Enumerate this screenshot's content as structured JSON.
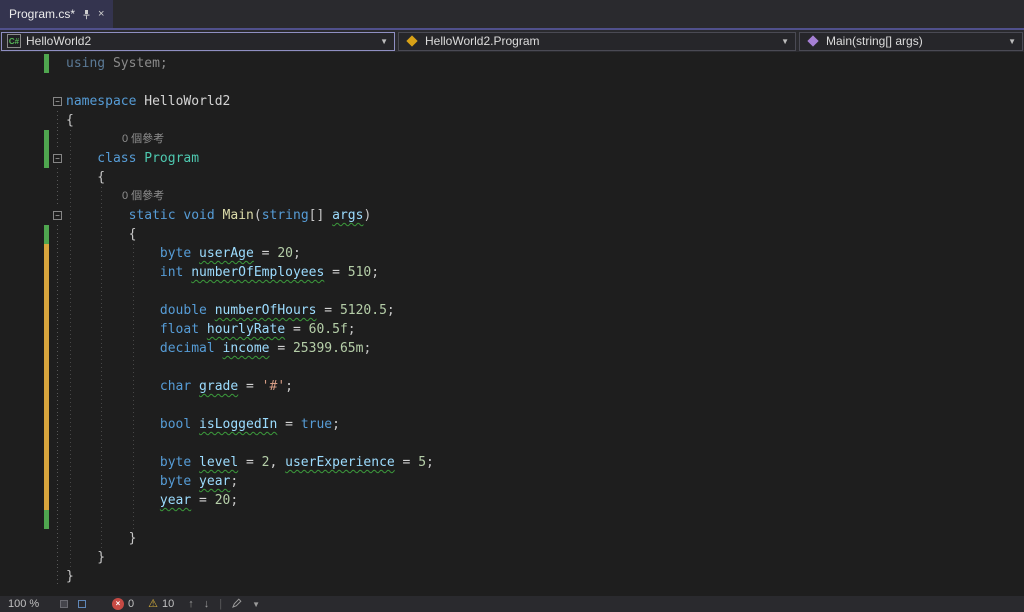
{
  "tab_bar": {
    "tabs": [
      {
        "title": "Program.cs*"
      }
    ]
  },
  "breadcrumbs": {
    "project": "HelloWorld2",
    "type": "HelloWorld2.Program",
    "member": "Main(string[] args)"
  },
  "editor": {
    "codelens_text": "0 個參考",
    "lines": [
      {
        "g": "g",
        "tk": [
          [
            "using",
            "dimkw"
          ],
          [
            " System;",
            "dim"
          ]
        ]
      },
      {},
      {
        "f": true,
        "tk": [
          [
            "namespace",
            "kw"
          ],
          [
            " HelloWorld2",
            "plain"
          ]
        ]
      },
      {
        "guide": true,
        "tk": [
          [
            "{",
            "punc"
          ]
        ]
      },
      {
        "g": "g",
        "guide": true,
        "cl": true
      },
      {
        "i": 1,
        "g": "g",
        "f": true,
        "tk": [
          [
            "class",
            "kw"
          ],
          [
            " ",
            "plain"
          ],
          [
            "Program",
            "type"
          ]
        ]
      },
      {
        "i": 1,
        "guide": true,
        "tk": [
          [
            "{",
            "punc"
          ]
        ]
      },
      {
        "guide": true,
        "cl": true
      },
      {
        "i": 2,
        "f": true,
        "tk": [
          [
            "static",
            "kw"
          ],
          [
            " ",
            "plain"
          ],
          [
            "void",
            "kw"
          ],
          [
            " ",
            "plain"
          ],
          [
            "Main",
            "method"
          ],
          [
            "(",
            "punc"
          ],
          [
            "string",
            "kw"
          ],
          [
            "[] ",
            "punc"
          ],
          [
            "args",
            "id",
            true
          ],
          [
            ")",
            "punc"
          ]
        ]
      },
      {
        "i": 2,
        "g": "g",
        "guide": true,
        "tk": [
          [
            "{",
            "punc"
          ]
        ]
      },
      {
        "i": 3,
        "g": "y",
        "guide": true,
        "tk": [
          [
            "byte",
            "kw"
          ],
          [
            " ",
            "plain"
          ],
          [
            "userAge",
            "id",
            true
          ],
          [
            " = ",
            "plain"
          ],
          [
            "20",
            "num"
          ],
          [
            ";",
            "punc"
          ]
        ]
      },
      {
        "i": 3,
        "g": "y",
        "guide": true,
        "tk": [
          [
            "int",
            "kw"
          ],
          [
            " ",
            "plain"
          ],
          [
            "numberOfEmployees",
            "id",
            true
          ],
          [
            " = ",
            "plain"
          ],
          [
            "510",
            "num"
          ],
          [
            ";",
            "punc"
          ]
        ]
      },
      {
        "g": "y",
        "guide": true
      },
      {
        "i": 3,
        "g": "y",
        "guide": true,
        "tk": [
          [
            "double",
            "kw"
          ],
          [
            " ",
            "plain"
          ],
          [
            "numberOfHours",
            "id",
            true
          ],
          [
            " = ",
            "plain"
          ],
          [
            "5120.5",
            "num"
          ],
          [
            ";",
            "punc"
          ]
        ]
      },
      {
        "i": 3,
        "g": "y",
        "guide": true,
        "tk": [
          [
            "float",
            "kw"
          ],
          [
            " ",
            "plain"
          ],
          [
            "hourlyRate",
            "id",
            true
          ],
          [
            " = ",
            "plain"
          ],
          [
            "60.5f",
            "num"
          ],
          [
            ";",
            "punc"
          ]
        ]
      },
      {
        "i": 3,
        "g": "y",
        "guide": true,
        "tk": [
          [
            "decimal",
            "kw"
          ],
          [
            " ",
            "plain"
          ],
          [
            "income",
            "id",
            true
          ],
          [
            " = ",
            "plain"
          ],
          [
            "25399.65m",
            "num"
          ],
          [
            ";",
            "punc"
          ]
        ]
      },
      {
        "g": "y",
        "guide": true
      },
      {
        "i": 3,
        "g": "y",
        "guide": true,
        "tk": [
          [
            "char",
            "kw"
          ],
          [
            " ",
            "plain"
          ],
          [
            "grade",
            "id",
            true
          ],
          [
            " = ",
            "plain"
          ],
          [
            "'#'",
            "str"
          ],
          [
            ";",
            "punc"
          ]
        ]
      },
      {
        "g": "y",
        "guide": true
      },
      {
        "i": 3,
        "g": "y",
        "guide": true,
        "tk": [
          [
            "bool",
            "kw"
          ],
          [
            " ",
            "plain"
          ],
          [
            "isLoggedIn",
            "id",
            true
          ],
          [
            " = ",
            "plain"
          ],
          [
            "true",
            "kw"
          ],
          [
            ";",
            "punc"
          ]
        ]
      },
      {
        "g": "y",
        "guide": true
      },
      {
        "i": 3,
        "g": "y",
        "guide": true,
        "tk": [
          [
            "byte",
            "kw"
          ],
          [
            " ",
            "plain"
          ],
          [
            "level",
            "id",
            true
          ],
          [
            " = ",
            "plain"
          ],
          [
            "2",
            "num"
          ],
          [
            ", ",
            "plain"
          ],
          [
            "userExperience",
            "id",
            true
          ],
          [
            " = ",
            "plain"
          ],
          [
            "5",
            "num"
          ],
          [
            ";",
            "punc"
          ]
        ]
      },
      {
        "i": 3,
        "g": "y",
        "guide": true,
        "tk": [
          [
            "byte",
            "kw"
          ],
          [
            " ",
            "plain"
          ],
          [
            "year",
            "id",
            true
          ],
          [
            ";",
            "punc"
          ]
        ]
      },
      {
        "i": 3,
        "g": "y",
        "guide": true,
        "tk": [
          [
            "year",
            "id",
            true
          ],
          [
            " = ",
            "plain"
          ],
          [
            "20",
            "num"
          ],
          [
            ";",
            "punc"
          ]
        ]
      },
      {
        "g": "g",
        "guide": true
      },
      {
        "i": 2,
        "guide": true,
        "tk": [
          [
            "}",
            "punc"
          ]
        ]
      },
      {
        "i": 1,
        "guide": true,
        "tk": [
          [
            "}",
            "punc"
          ]
        ]
      },
      {
        "guide": true,
        "tk": [
          [
            "}",
            "punc"
          ]
        ]
      },
      {}
    ]
  },
  "status_bar": {
    "zoom": "100 %",
    "error_count": "0",
    "warning_count": "10"
  },
  "icons": {
    "close": "×",
    "caret": "▼",
    "collapse": "−",
    "csharp": "C#",
    "error": "×",
    "warning": "⚠",
    "arrow_up": "↑",
    "arrow_down": "↓",
    "divider": "|"
  },
  "colors": {
    "accent_line": "#50508c",
    "active_tab_bg": "#34344f",
    "keyword": "#569cd6",
    "type_name": "#4ec9b0",
    "identifier": "#9cdcfe",
    "number": "#b5cea8",
    "string": "#d69d85",
    "squiggle": "#3c9b3c",
    "gutter_saved": "#4fa64f",
    "gutter_unsaved": "#d8a53d",
    "error": "#c74a44",
    "warning": "#d9b13b"
  }
}
